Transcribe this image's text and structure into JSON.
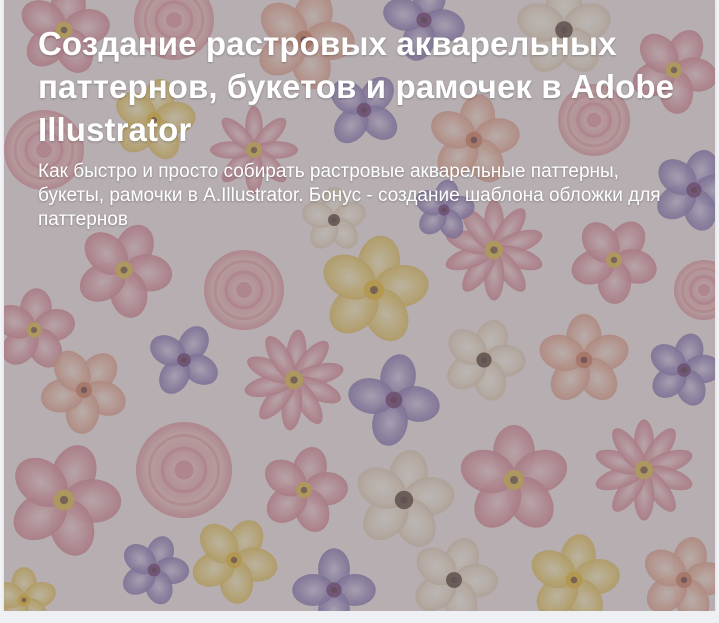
{
  "card": {
    "title": "Создание растровых акварельных паттернов, букетов и рамочек в Adobe Illustrator",
    "description": "Как быстро и просто собирать растровые акварельные паттерны, букеты, рамочки в A.Illustrator. Бонус - создание шаблона обложки для паттернов"
  },
  "colors": {
    "overlay": "#5f5a5f",
    "text": "#ffffff",
    "page_background": "#f1f3f6",
    "flower_pink": "#e6a0ad",
    "flower_peach": "#efc2b4",
    "flower_yellow": "#f1d98a",
    "flower_violet": "#9a8ac2",
    "flower_cream": "#f4e7d5"
  },
  "background_art": "watercolor-flower-pattern"
}
